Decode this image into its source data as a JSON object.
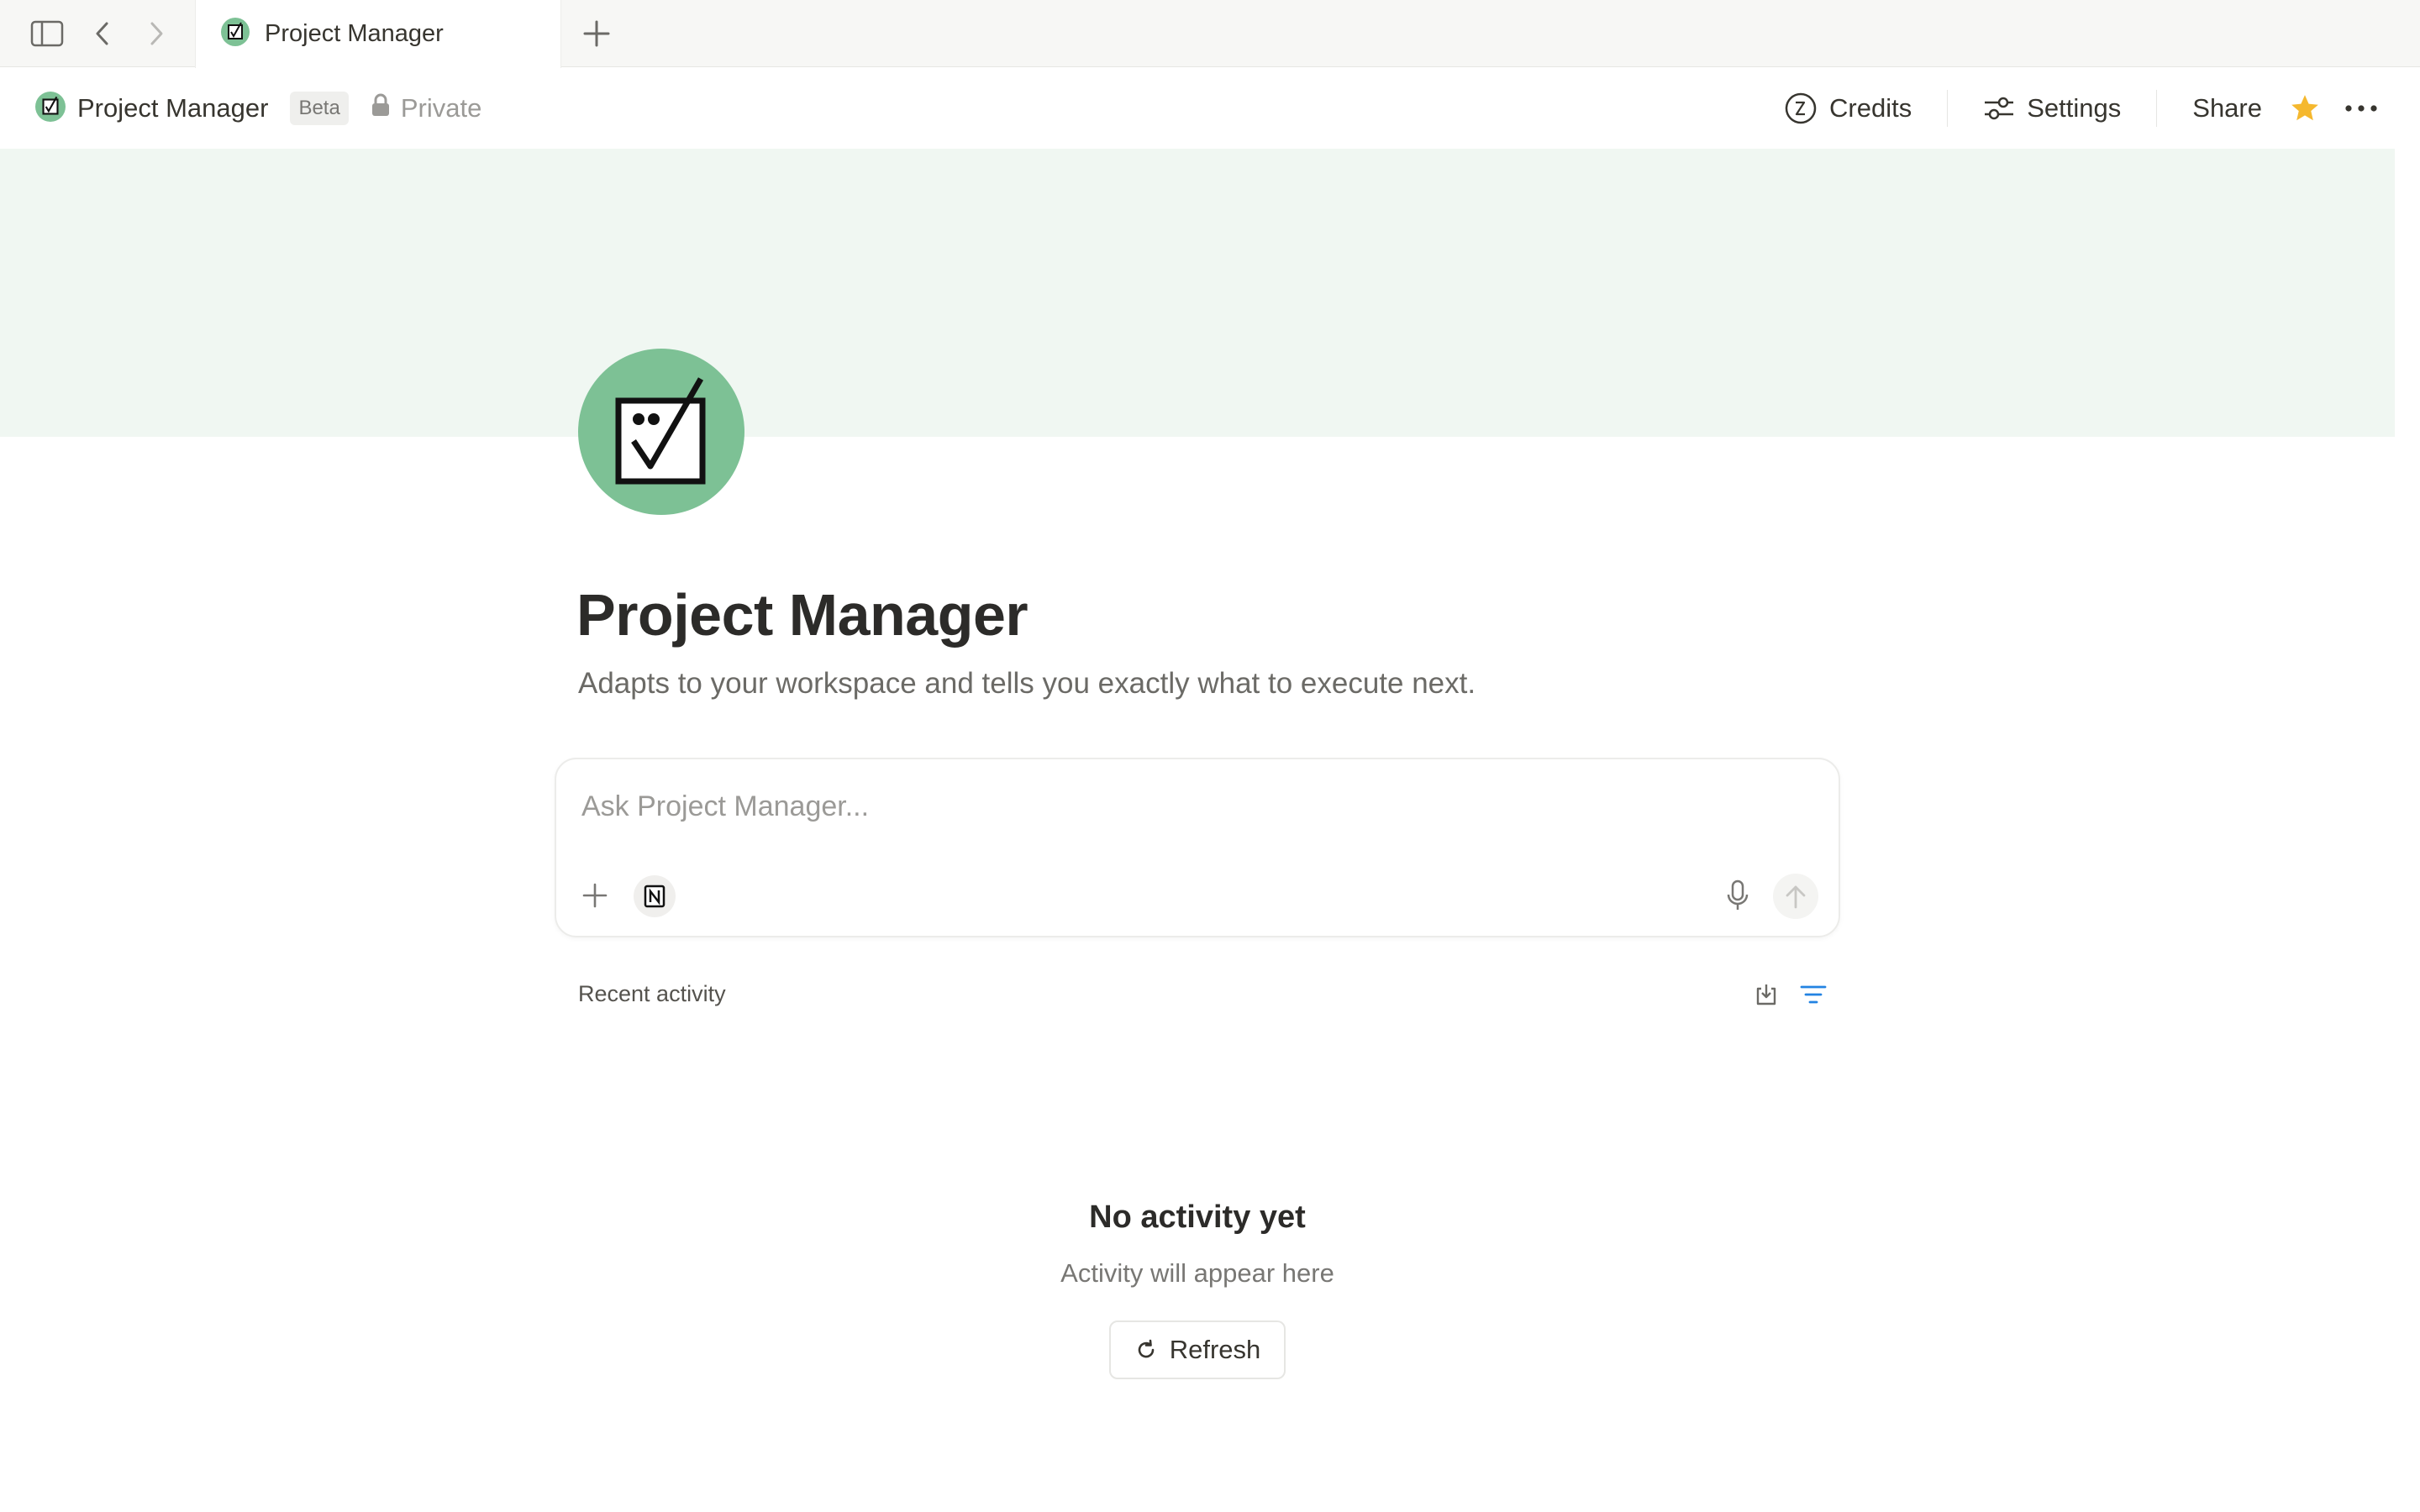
{
  "tabbar": {
    "active_tab_label": "Project Manager"
  },
  "header": {
    "title": "Project Manager",
    "badge": "Beta",
    "privacy": "Private",
    "credits_label": "Credits",
    "settings_label": "Settings",
    "share_label": "Share"
  },
  "page": {
    "title": "Project Manager",
    "description": "Adapts to your workspace and tells you exactly what to execute next."
  },
  "ask": {
    "placeholder": "Ask Project Manager..."
  },
  "activity": {
    "label": "Recent activity",
    "empty_title": "No activity yet",
    "empty_subtitle": "Activity will appear here",
    "refresh_label": "Refresh"
  },
  "colors": {
    "cover": "#f0f7f2",
    "avatar": "#7dc195",
    "star": "#f5b82e",
    "filter_accent": "#2383e2"
  },
  "icons": {
    "sidebar": "sidebar-toggle-icon",
    "back": "chevron-left-icon",
    "forward": "chevron-right-icon",
    "new_tab": "plus-icon",
    "agent": "checkbox-face-icon",
    "lock": "lock-icon",
    "credits": "credits-icon",
    "settings": "sliders-icon",
    "favorite": "star-icon",
    "more": "more-horizontal-icon",
    "add": "plus-icon",
    "notion": "notion-logo-icon",
    "mic": "microphone-icon",
    "send": "arrow-up-icon",
    "export": "download-icon",
    "filter": "filter-icon",
    "refresh": "refresh-icon"
  }
}
